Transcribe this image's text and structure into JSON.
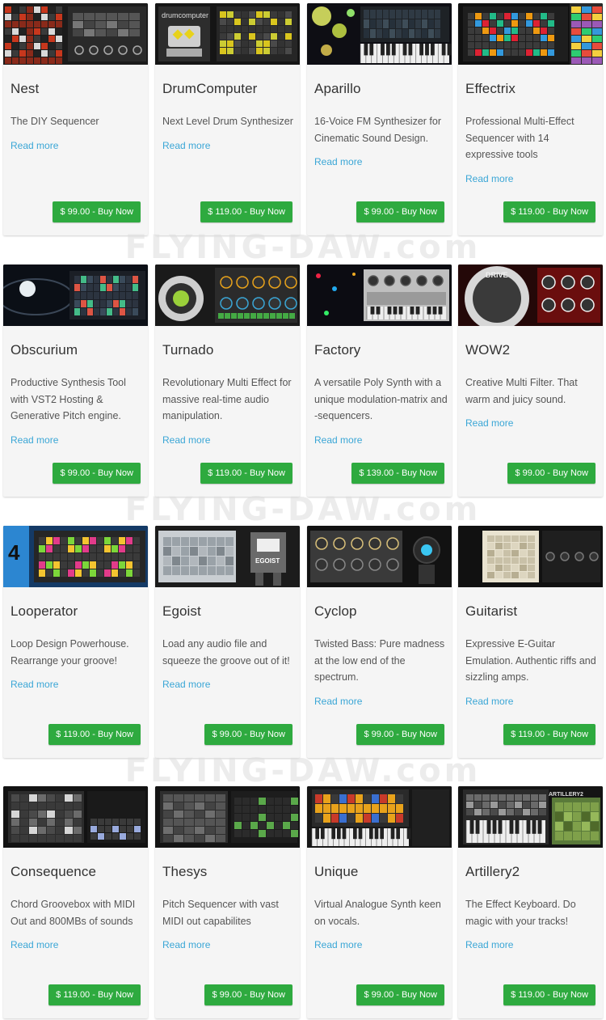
{
  "watermark": "FLYING-DAW.com",
  "read_more_label": "Read more",
  "buy_suffix": "Buy Now",
  "products": [
    {
      "name": "Nest",
      "description": "The DIY Sequencer",
      "price": "$ 99.00",
      "thumb_icon": "sequencer-grid-screenshot"
    },
    {
      "name": "DrumComputer",
      "description": "Next Level Drum Synthesizer",
      "price": "$ 119.00",
      "thumb_icon": "drum-computer-screenshot",
      "thumb_text": "drumcomputer"
    },
    {
      "name": "Aparillo",
      "description": "16-Voice FM Synthesizer for Cinematic Sound Design.",
      "price": "$ 99.00",
      "thumb_icon": "fm-synth-keyboard-screenshot"
    },
    {
      "name": "Effectrix",
      "description": "Professional Multi-Effect Sequencer with 14 expressive tools",
      "price": "$ 119.00",
      "thumb_icon": "effect-sequencer-screenshot"
    },
    {
      "name": "Obscurium",
      "description": "Productive Synthesis Tool with VST2 Hosting & Generative Pitch engine.",
      "price": "$ 99.00",
      "thumb_icon": "orb-synth-screenshot"
    },
    {
      "name": "Turnado",
      "description": "Revolutionary Multi Effect for massive real-time audio manipulation.",
      "price": "$ 119.00",
      "thumb_icon": "knob-effect-screenshot"
    },
    {
      "name": "Factory",
      "description": "A versatile Poly Synth with a unique modulation-matrix and -sequencers.",
      "price": "$ 139.00",
      "thumb_icon": "poly-synth-screenshot"
    },
    {
      "name": "WOW2",
      "description": "Creative Multi Filter. That warm and juicy sound.",
      "price": "$ 99.00",
      "thumb_icon": "filter-plugin-screenshot",
      "thumb_text": "DRIVE"
    },
    {
      "name": "Looperator",
      "description": "Loop Design Powerhouse. Rearrange your groove!",
      "price": "$ 119.00",
      "thumb_icon": "loop-sequencer-screenshot"
    },
    {
      "name": "Egoist",
      "description": "Load any audio file and squeeze the groove out of it!",
      "price": "$ 99.00",
      "thumb_icon": "robot-sampler-screenshot",
      "thumb_text": "EGOIST"
    },
    {
      "name": "Cyclop",
      "description": "Twisted Bass: Pure madness at the low end of the spectrum.",
      "price": "$ 99.00",
      "thumb_icon": "bass-synth-robot-screenshot"
    },
    {
      "name": "Guitarist",
      "description": "Expressive E-Guitar Emulation. Authentic riffs and sizzling amps.",
      "price": "$ 119.00",
      "thumb_icon": "guitar-plugin-screenshot"
    },
    {
      "name": "Consequence",
      "description": "Chord Groovebox with MIDI Out and 800MBs of sounds",
      "price": "$ 119.00",
      "thumb_icon": "groovebox-screenshot"
    },
    {
      "name": "Thesys",
      "description": "Pitch Sequencer with vast MIDI out capabilites",
      "price": "$ 99.00",
      "thumb_icon": "pitch-sequencer-screenshot"
    },
    {
      "name": "Unique",
      "description": "Virtual Analogue Synth keen on vocals.",
      "price": "$ 99.00",
      "thumb_icon": "analogue-synth-screenshot"
    },
    {
      "name": "Artillery2",
      "description": "The Effect Keyboard. Do magic with your tracks!",
      "price": "$ 119.00",
      "thumb_icon": "effect-keyboard-screenshot",
      "thumb_text": "ARTILLERY2"
    }
  ]
}
